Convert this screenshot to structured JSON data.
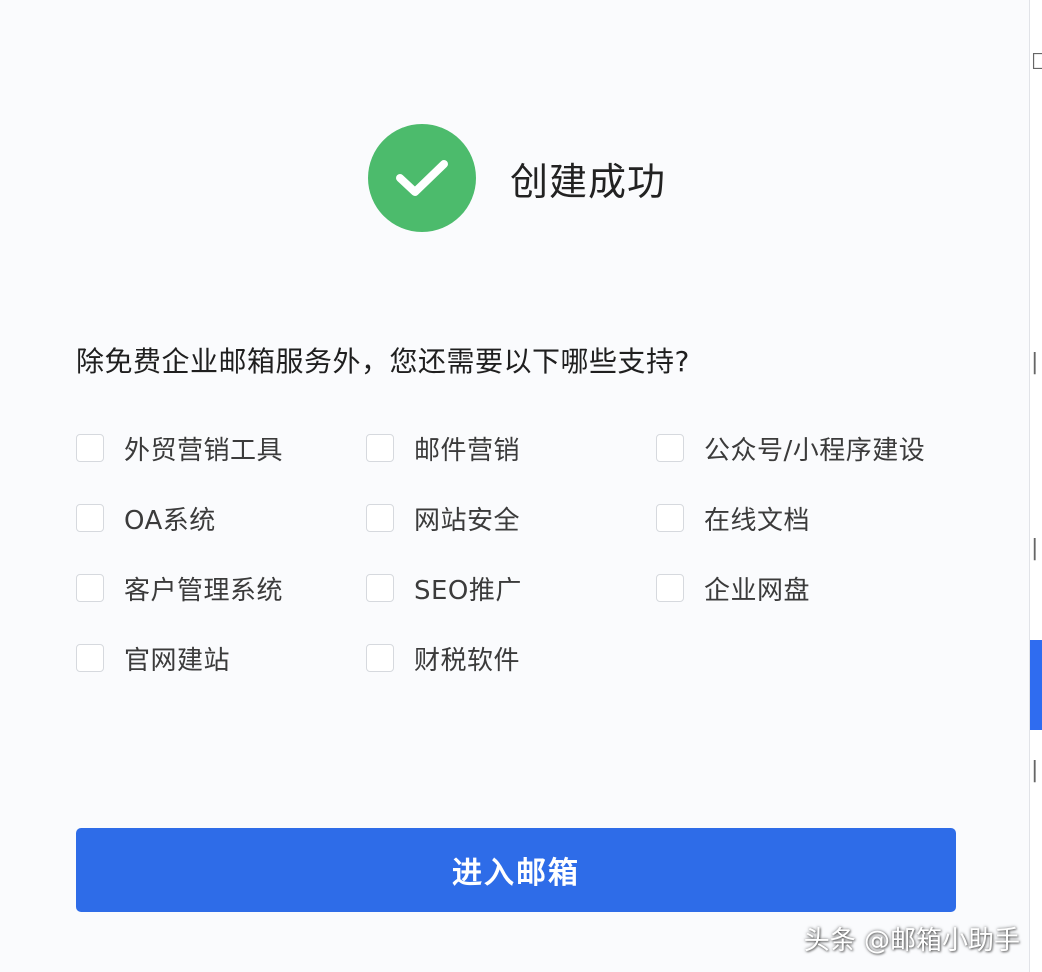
{
  "dialog": {
    "success_title": "创建成功",
    "question": "除免费企业邮箱服务外，您还需要以下哪些支持?",
    "options": [
      [
        "外贸营销工具",
        "邮件营销",
        "公众号/小程序建设"
      ],
      [
        "OA系统",
        "网站安全",
        "在线文档"
      ],
      [
        "客户管理系统",
        "SEO推广",
        "企业网盘"
      ],
      [
        "官网建站",
        "财税软件"
      ]
    ],
    "enter_button": "进入邮箱"
  },
  "watermark": "头条 @邮箱小助手",
  "colors": {
    "success": "#4cbb6c",
    "primary": "#2e6ce8"
  },
  "icons": {
    "success": "check-circle-icon",
    "checkbox": "checkbox-unchecked"
  }
}
